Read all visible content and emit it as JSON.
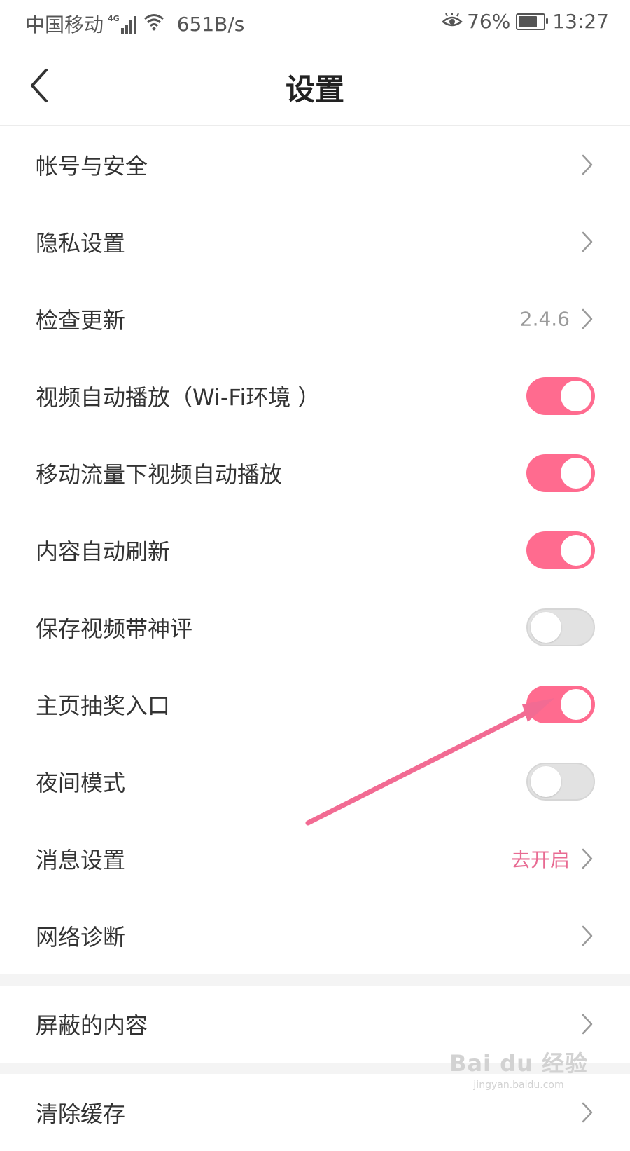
{
  "status_bar": {
    "carrier": "中国移动",
    "network_type": "4G",
    "speed": "651B/s",
    "battery": "76%",
    "battery_level": 76,
    "time": "13:27"
  },
  "nav": {
    "title": "设置",
    "back_icon": "chevron-left-icon"
  },
  "colors": {
    "accent": "#ff6b8f",
    "accent_text": "#e86a92",
    "toggle_off": "#e2e2e2"
  },
  "settings": [
    {
      "label": "帐号与安全",
      "type": "link"
    },
    {
      "label": "隐私设置",
      "type": "link"
    },
    {
      "label": "检查更新",
      "type": "link",
      "value": "2.4.6"
    },
    {
      "label": "视频自动播放（Wi-Fi环境 ）",
      "type": "toggle",
      "on": true
    },
    {
      "label": "移动流量下视频自动播放",
      "type": "toggle",
      "on": true
    },
    {
      "label": "内容自动刷新",
      "type": "toggle",
      "on": true
    },
    {
      "label": "保存视频带神评",
      "type": "toggle",
      "on": false
    },
    {
      "label": "主页抽奖入口",
      "type": "toggle",
      "on": true
    },
    {
      "label": "夜间模式",
      "type": "toggle",
      "on": false
    },
    {
      "label": "消息设置",
      "type": "link",
      "value": "去开启"
    },
    {
      "label": "网络诊断",
      "type": "link"
    }
  ],
  "section2": [
    {
      "label": "屏蔽的内容",
      "type": "link"
    }
  ],
  "section3": [
    {
      "label": "清除缓存",
      "type": "link"
    }
  ],
  "watermark": {
    "main": "Bai du 经验",
    "sub": "jingyan.baidu.com"
  }
}
